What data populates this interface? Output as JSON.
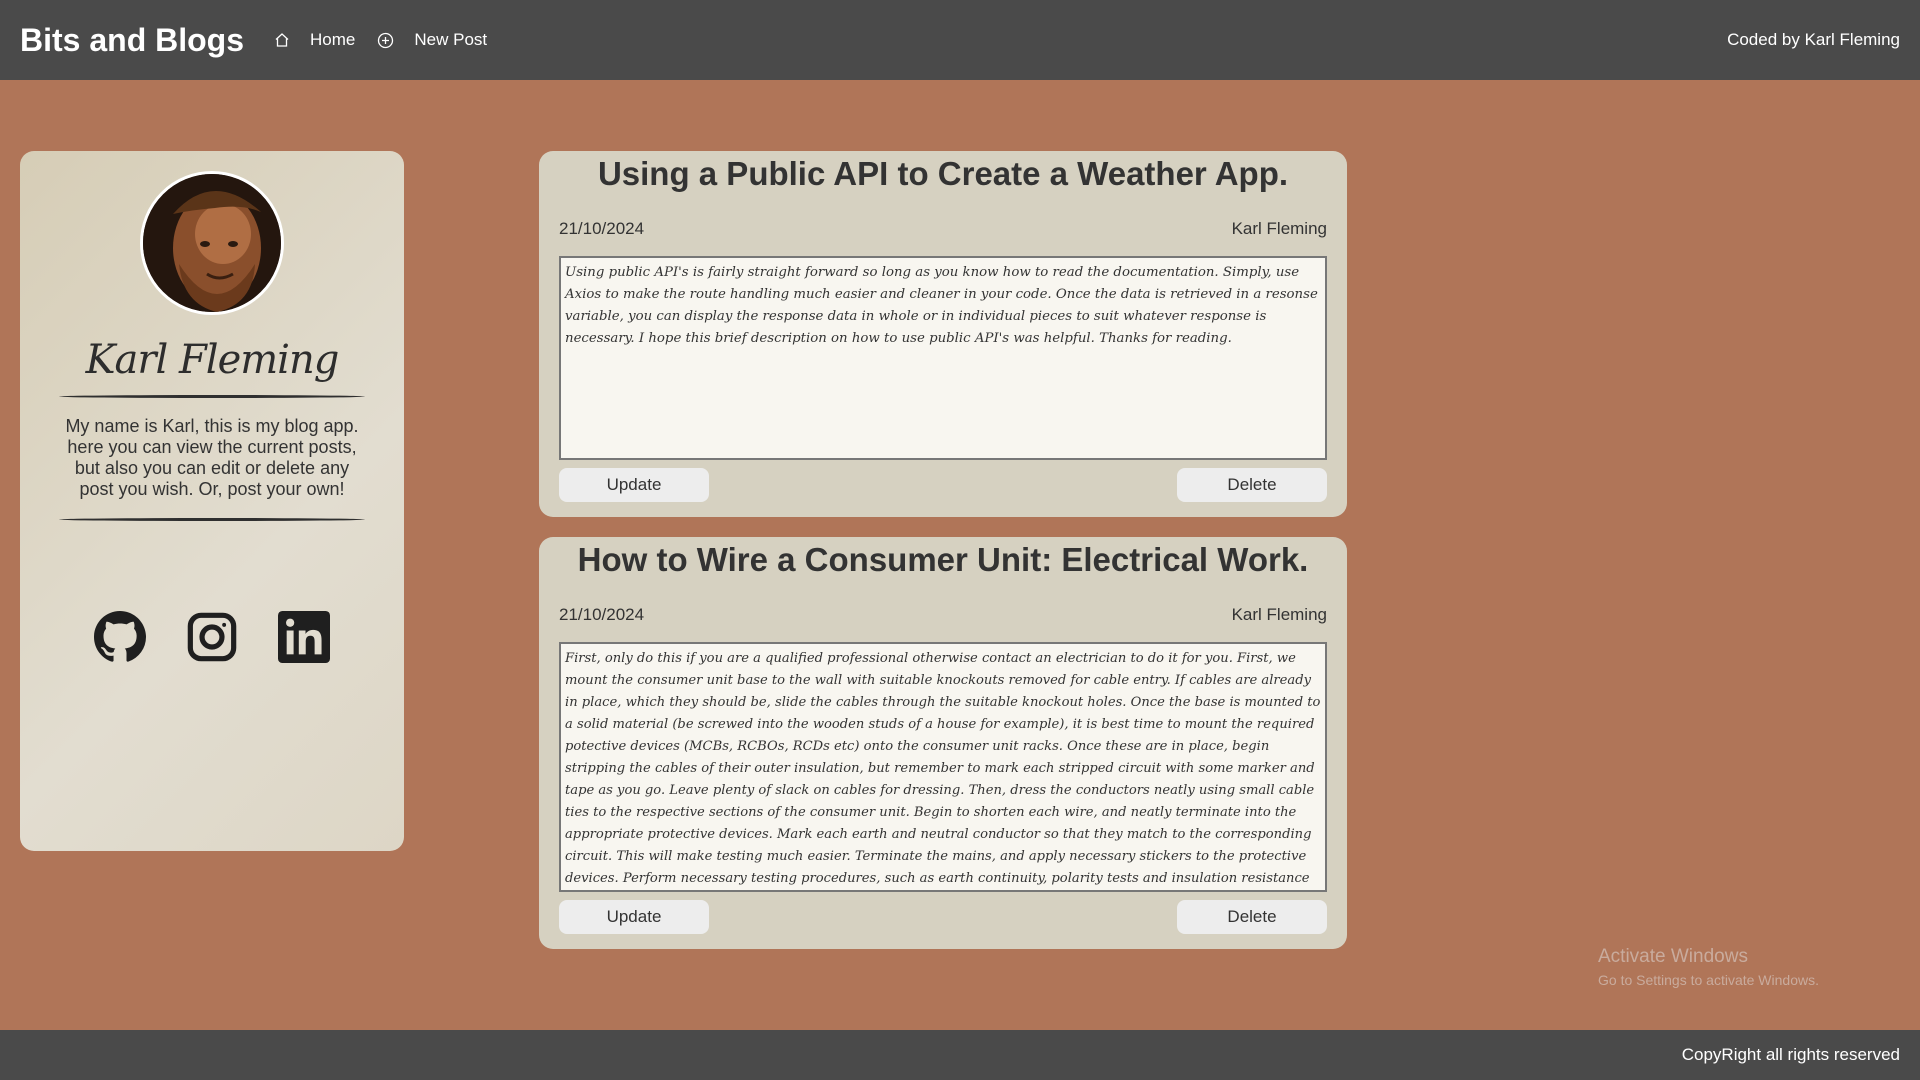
{
  "header": {
    "brand": "Bits and Blogs",
    "nav": [
      {
        "label": "Home",
        "icon": "home-icon"
      },
      {
        "label": "New Post",
        "icon": "plus-circle-icon"
      }
    ],
    "credit": "Coded by Karl Fleming"
  },
  "profile": {
    "signature": "Karl Fleming",
    "bio": "My name is Karl, this is my blog app. here you can view the current posts, but also you can edit or delete any post you wish. Or, post your own!",
    "socials": [
      "github-icon",
      "instagram-icon",
      "linkedin-icon"
    ]
  },
  "posts": [
    {
      "title": "Using a Public API to Create a Weather App.",
      "date": "21/10/2024",
      "author": "Karl Fleming",
      "body": "Using public API's is fairly straight forward so long as you know how to read the documentation. Simply, use Axios to make the route handling much easier and cleaner in your code. Once the data is retrieved in a resonse variable, you can display the response data in whole or in individual pieces to suit whatever response is necessary. I hope this brief description on how to use public API's was helpful. Thanks for reading.",
      "update_label": "Update",
      "delete_label": "Delete"
    },
    {
      "title": "How to Wire a Consumer Unit: Electrical Work.",
      "date": "21/10/2024",
      "author": "Karl Fleming",
      "body": "First, only do this if you are a qualified professional otherwise contact an electrician to do it for you. First, we mount the consumer unit base to the wall with suitable knockouts removed for cable entry. If cables are already in place, which they should be, slide the cables through the suitable knockout holes. Once the base is mounted to a solid material (be screwed into the wooden studs of a house for example), it is best time to mount the required potective devices (MCBs, RCBOs, RCDs etc) onto the consumer unit racks. Once these are in place, begin stripping the cables of their outer insulation, but remember to mark each stripped circuit with some marker and tape as you go. Leave plenty of slack on cables for dressing. Then, dress the conductors neatly using small cable ties to the respective sections of the consumer unit. Begin to shorten each wire, and neatly terminate into the appropriate protective devices. Mark each earth and neutral conductor so that they match to the corresponding circuit. This will make testing much easier. Terminate the mains, and apply necessary stickers to the protective devices. Perform necessary testing procedures, such as earth continuity, polarity tests and insulation resistance tests. Power on each circuit, one at a time, to confirm functionality. Mount the protective cover to the board.",
      "update_label": "Update",
      "delete_label": "Delete"
    }
  ],
  "footer": {
    "text": "CopyRight all rights reserved"
  },
  "watermark": {
    "line1": "Activate Windows",
    "line2": "Go to Settings to activate Windows."
  },
  "colors": {
    "background": "#b07558",
    "header": "#4a4a4a",
    "card": "#d6d1c1"
  }
}
